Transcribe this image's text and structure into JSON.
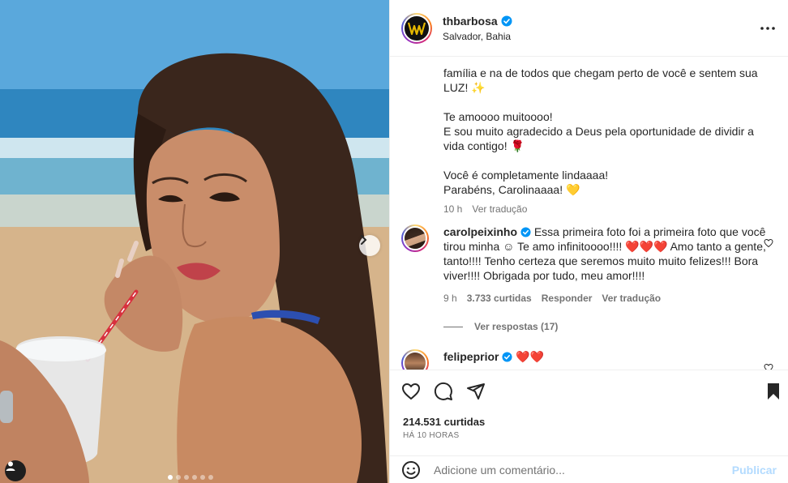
{
  "post": {
    "author": "thbarbosa",
    "location": "Salvador, Bahia",
    "likes": "214.531 curtidas",
    "time_ago": "HÁ 10 HORAS"
  },
  "caption": {
    "line1": "família e na de todos que chegam perto de você e sentem sua",
    "line2": "LUZ! ✨",
    "line3": "Te amoooo muitoooo!",
    "line4": "E sou muito agradecido a Deus pela oportunidade de dividir a",
    "line5": "vida contigo! 🌹",
    "line6": "Você é completamente lindaaaa!",
    "line7": "Parabéns, Carolinaaaa! 💛",
    "time": "10 h",
    "translate": "Ver tradução"
  },
  "comments": [
    {
      "user": "carolpeixinho",
      "text": "Essa primeira foto foi a primeira foto que você tirou minha ☺ Te amo infinitoooo!!!! ❤️❤️❤️ Amo tanto a gente, tanto!!!! Tenho certeza que seremos muito muito felizes!!! Bora viver!!!! Obrigada por tudo, meu amor!!!!",
      "time": "9 h",
      "likes": "3.733 curtidas",
      "reply": "Responder",
      "translate": "Ver tradução",
      "view_replies": "Ver respostas (17)"
    },
    {
      "user": "felipeprior",
      "text": "❤️❤️"
    }
  ],
  "composer": {
    "placeholder": "Adicione um comentário...",
    "publish": "Publicar"
  },
  "carousel": {
    "count": 6,
    "active": 0
  },
  "colors": {
    "verified": "#0095f6",
    "publish": "#b3dbff",
    "heart": "#ed4956"
  },
  "icons": [
    "logo-icon",
    "verified-icon",
    "more-icon",
    "heart-icon",
    "comment-icon",
    "share-icon",
    "bookmark-icon",
    "emoji-icon",
    "chevron-right-icon",
    "user-tag-icon"
  ]
}
